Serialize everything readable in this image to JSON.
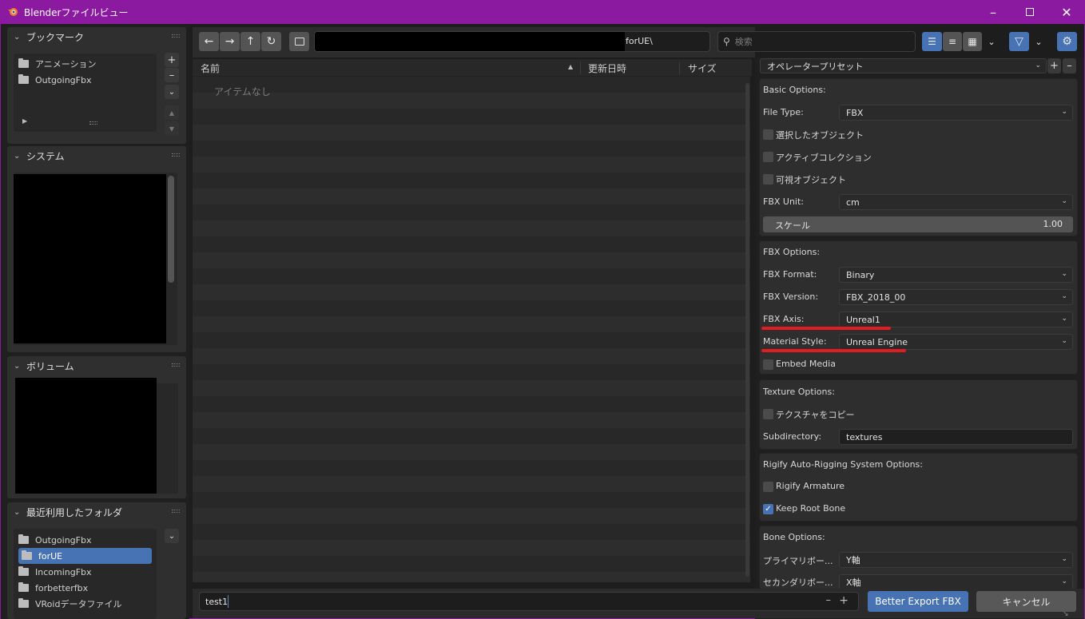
{
  "window": {
    "title": "Blenderファイルビュー",
    "min_icon": "minimize-icon",
    "max_icon": "maximize-icon",
    "close_icon": "close-icon"
  },
  "sidebar": {
    "bookmarks": {
      "title": "ブックマーク",
      "items": [
        {
          "label": "アニメーション"
        },
        {
          "label": "OutgoingFbx"
        }
      ]
    },
    "system": {
      "title": "システム"
    },
    "volumes": {
      "title": "ボリューム"
    },
    "recent": {
      "title": "最近利用したフォルダ",
      "items": [
        {
          "label": "OutgoingFbx"
        },
        {
          "label": "forUE",
          "selected": true
        },
        {
          "label": "IncomingFbx"
        },
        {
          "label": "forbetterfbx"
        },
        {
          "label": "VRoidデータファイル"
        }
      ]
    }
  },
  "toolbar": {
    "path_suffix": "forUE\\",
    "search_placeholder": "検索",
    "icons": [
      "back-icon",
      "forward-icon",
      "parent-dir-icon",
      "refresh-icon",
      "new-folder-icon",
      "vertical-list-icon",
      "horizontal-list-icon",
      "thumbnails-icon",
      "filter-icon",
      "settings-icon"
    ]
  },
  "filelist": {
    "columns": {
      "name": "名前",
      "modified": "更新日時",
      "size": "サイズ"
    },
    "empty_text": "アイテムなし"
  },
  "operator": {
    "preset_label": "オペレータープリセット",
    "basic": {
      "title": "Basic Options:",
      "file_type_label": "File Type:",
      "file_type_value": "FBX",
      "selected_objects": "選択したオブジェクト",
      "active_collection": "アクティブコレクション",
      "visible_objects": "可視オブジェクト",
      "unit_label": "FBX Unit:",
      "unit_value": "cm",
      "scale_label": "スケール",
      "scale_value": "1.00"
    },
    "fbx": {
      "title": "FBX Options:",
      "format_label": "FBX Format:",
      "format_value": "Binary",
      "version_label": "FBX Version:",
      "version_value": "FBX_2018_00",
      "axis_label": "FBX Axis:",
      "axis_value": "Unreal1",
      "material_label": "Material Style:",
      "material_value": "Unreal Engine",
      "embed_media": "Embed Media"
    },
    "texture": {
      "title": "Texture Options:",
      "copy_textures": "テクスチャをコピー",
      "subdir_label": "Subdirectory:",
      "subdir_value": "textures"
    },
    "rigify": {
      "title": "Rigify Auto-Rigging System Options:",
      "rigify_armature": "Rigify Armature",
      "keep_root_bone": "Keep Root Bone",
      "keep_root_bone_checked": true
    },
    "bone": {
      "title": "Bone Options:",
      "primary_label": "プライマリボー...",
      "primary_value": "Y軸",
      "secondary_label": "セカンダリボー...",
      "secondary_value": "X軸"
    }
  },
  "bottom": {
    "filename": "test1",
    "export_label": "Better Export FBX",
    "cancel_label": "キャンセル"
  },
  "colors": {
    "title_bar": "#8b1aa1",
    "accent": "#4772b3",
    "highlight": "#e31b23"
  }
}
